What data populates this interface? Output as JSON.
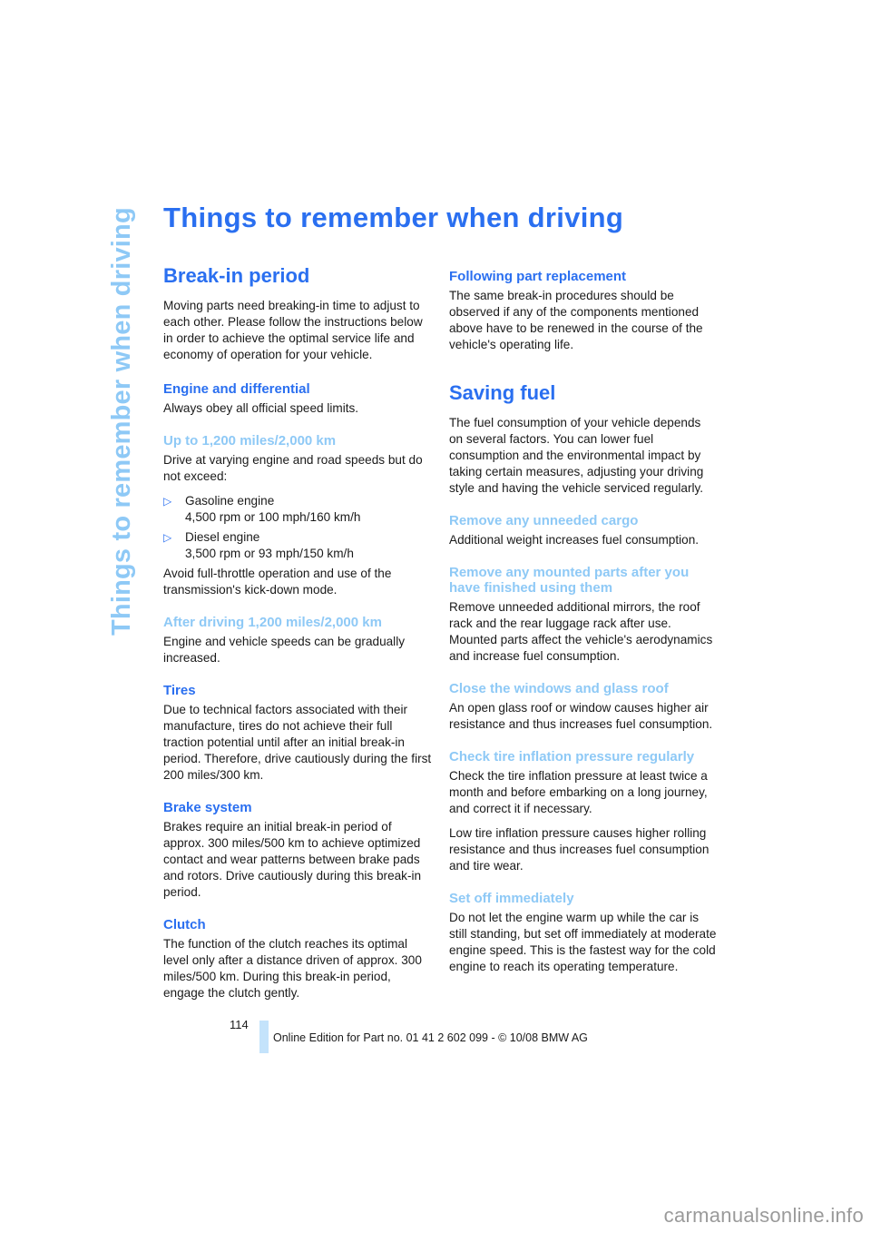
{
  "side_title": "Things to remember when driving",
  "page_title": "Things to remember when driving",
  "left_column": {
    "break_in": {
      "heading": "Break-in period",
      "text": "Moving parts need breaking-in time to adjust to each other. Please follow the instructions below in order to achieve the optimal service life and economy of operation for your vehicle."
    },
    "engine": {
      "heading": "Engine and differential",
      "text": "Always obey all official speed limits."
    },
    "up_to": {
      "heading": "Up to 1,200 miles/2,000 km",
      "text": "Drive at varying engine and road speeds but do not exceed:",
      "bullets": [
        {
          "line1": "Gasoline engine",
          "line2": "4,500 rpm or 100 mph/160 km/h"
        },
        {
          "line1": "Diesel engine",
          "line2": "3,500 rpm or 93 mph/150 km/h"
        }
      ],
      "bullet_glyph": "▷",
      "after": "Avoid full-throttle operation and use of the transmission's kick-down mode."
    },
    "after_driving": {
      "heading": "After driving 1,200 miles/2,000 km",
      "text": "Engine and vehicle speeds can be gradually increased."
    },
    "tires": {
      "heading": "Tires",
      "text": "Due to technical factors associated with their manufacture, tires do not achieve their full traction potential until after an initial break-in period. Therefore, drive cautiously during the first 200 miles/300 km."
    },
    "brakes": {
      "heading": "Brake system",
      "text": "Brakes require an initial break-in period of approx. 300 miles/500 km to achieve optimized contact and wear patterns between brake pads and rotors. Drive cautiously during this break-in period."
    },
    "clutch": {
      "heading": "Clutch",
      "text": "The function of the clutch reaches its optimal level only after a distance driven of approx. 300 miles/500 km. During this break-in period, engage the clutch gently."
    }
  },
  "right_column": {
    "following": {
      "heading": "Following part replacement",
      "text": "The same break-in procedures should be observed if any of the components mentioned above have to be renewed in the course of the vehicle's operating life."
    },
    "saving_fuel": {
      "heading": "Saving fuel",
      "text": "The fuel consumption of your vehicle depends on several factors. You can lower fuel consumption and the environmental impact by taking certain measures, adjusting your driving style and having the vehicle serviced regularly."
    },
    "cargo": {
      "heading": "Remove any unneeded cargo",
      "text": "Additional weight increases fuel consumption."
    },
    "mounted": {
      "heading": "Remove any mounted parts after you have finished using them",
      "text": "Remove unneeded additional mirrors, the roof rack and the rear luggage rack after use. Mounted parts affect the vehicle's aerodynamics and increase fuel consumption."
    },
    "windows": {
      "heading": "Close the windows and glass roof",
      "text": "An open glass roof or window causes higher air resistance and thus increases fuel consumption."
    },
    "tire_pressure": {
      "heading": "Check tire inflation pressure regularly",
      "text1": "Check the tire inflation pressure at least twice a month and before embarking on a long journey, and correct it if necessary.",
      "text2": "Low tire inflation pressure causes higher rolling resistance and thus increases fuel consumption and tire wear."
    },
    "set_off": {
      "heading": "Set off immediately",
      "text": "Do not let the engine warm up while the car is still standing, but set off immediately at moderate engine speed. This is the fastest way for the cold engine to reach its operating temperature."
    }
  },
  "footer": {
    "page_number": "114",
    "edition": "Online Edition for Part no. 01 41 2 602 099 - © 10/08 BMW AG"
  },
  "watermark": "carmanualsonline.info",
  "colors": {
    "heading_blue": "#2a6ff0",
    "light_blue": "#8ec9f6",
    "footer_bar": "#c4e3fb"
  }
}
